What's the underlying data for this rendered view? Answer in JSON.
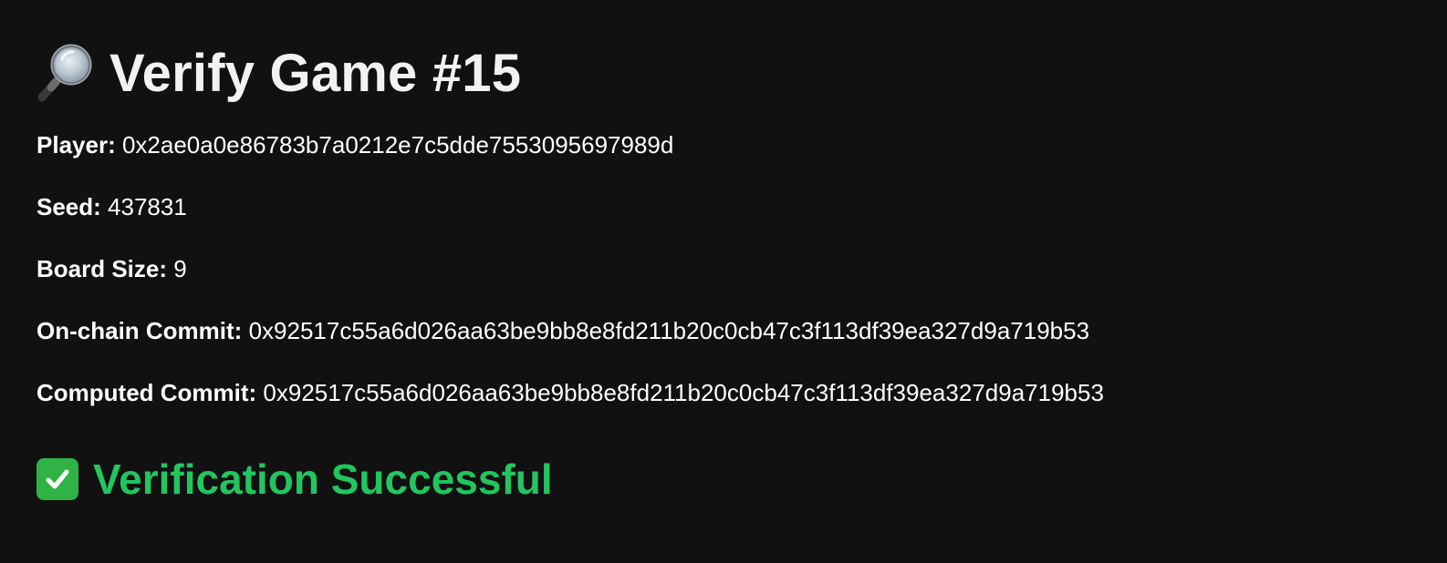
{
  "page": {
    "title": "Verify Game #15",
    "title_icon": "magnifying-glass-icon"
  },
  "details": {
    "player": {
      "label": "Player:",
      "value": "0x2ae0a0e86783b7a0212e7c5dde7553095697989d"
    },
    "seed": {
      "label": "Seed:",
      "value": "437831"
    },
    "board_size": {
      "label": "Board Size:",
      "value": "9"
    },
    "onchain_commit": {
      "label": "On-chain Commit:",
      "value": "0x92517c55a6d026aa63be9bb8e8fd211b20c0cb47c3f113df39ea327d9a719b53"
    },
    "computed_commit": {
      "label": "Computed Commit:",
      "value": "0x92517c55a6d026aa63be9bb8e8fd211b20c0cb47c3f113df39ea327d9a719b53"
    }
  },
  "status": {
    "text": "Verification Successful",
    "icon": "check-mark-icon",
    "color": "#22c55e"
  }
}
